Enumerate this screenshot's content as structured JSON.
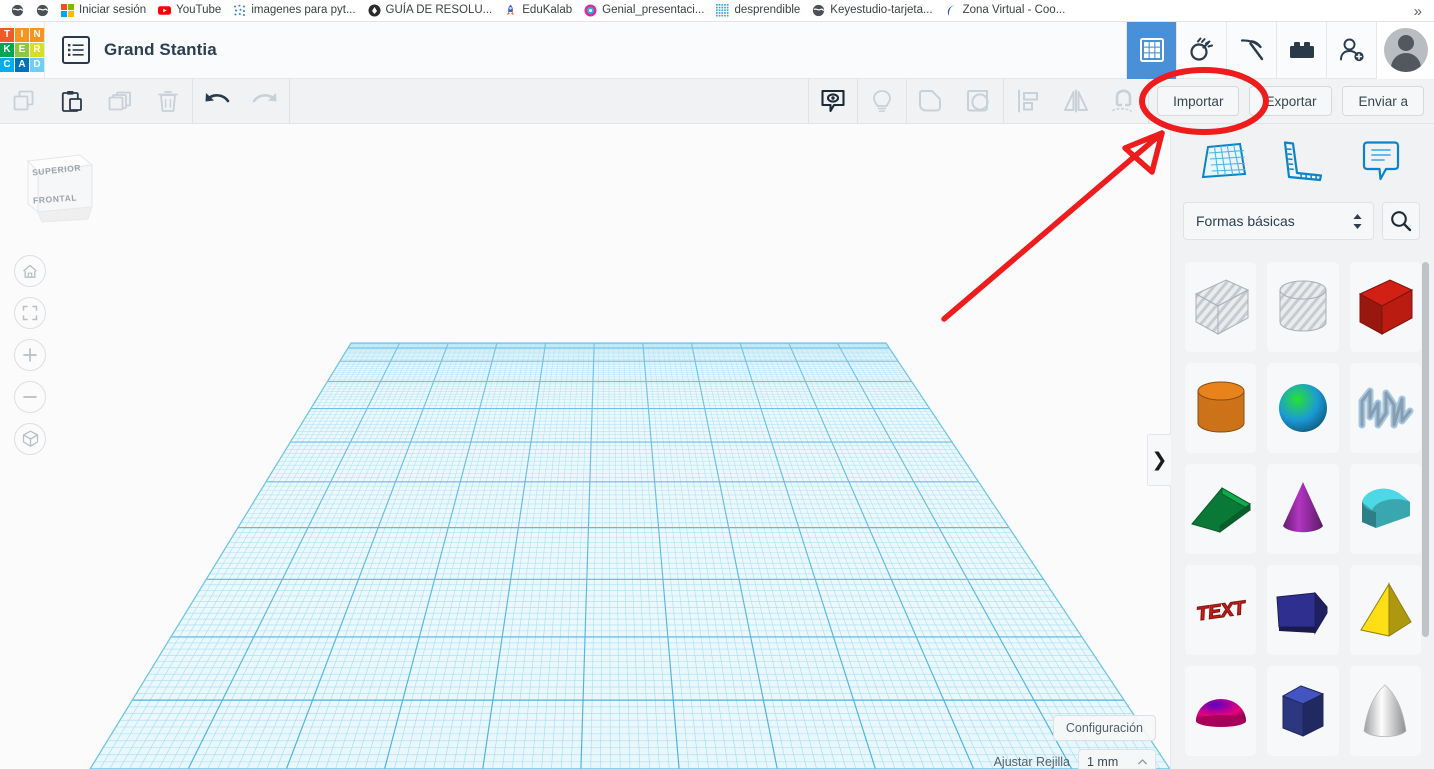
{
  "browser": {
    "bookmarks": [
      {
        "label": "",
        "icon": "globe-icon"
      },
      {
        "label": "",
        "icon": "globe-icon"
      },
      {
        "label": "Iniciar sesión",
        "icon": "microsoft-icon"
      },
      {
        "label": "YouTube",
        "icon": "youtube-icon"
      },
      {
        "label": "imagenes para pyt...",
        "icon": "dots-icon"
      },
      {
        "label": "GUÍA DE RESOLU...",
        "icon": "circle-badge-icon"
      },
      {
        "label": "EduKalab",
        "icon": "rocket-icon"
      },
      {
        "label": "Genial_presentaci...",
        "icon": "genially-icon"
      },
      {
        "label": "desprendible",
        "icon": "grid-dots-icon"
      },
      {
        "label": "Keyestudio-tarjeta...",
        "icon": "globe-icon"
      },
      {
        "label": "Zona Virtual - Coo...",
        "icon": "chevron-left-icon"
      }
    ],
    "overflow_label": "»"
  },
  "header": {
    "logo_letters": [
      {
        "char": "T",
        "color": "#f05a28"
      },
      {
        "char": "I",
        "color": "#f7941e"
      },
      {
        "char": "N",
        "color": "#f7941e"
      },
      {
        "char": "K",
        "color": "#00a651"
      },
      {
        "char": "E",
        "color": "#8dc63f"
      },
      {
        "char": "R",
        "color": "#d7df23"
      },
      {
        "char": "C",
        "color": "#00aeef"
      },
      {
        "char": "A",
        "color": "#0072bc"
      },
      {
        "char": "D",
        "color": "#6dcff6"
      }
    ],
    "project_title": "Grand Stantia",
    "list_button": "project-list-icon",
    "right_icons": [
      {
        "name": "designs-grid-icon",
        "active": true
      },
      {
        "name": "codeblocks-icon",
        "active": false
      },
      {
        "name": "pickaxe-minecraft-icon",
        "active": false
      },
      {
        "name": "lego-brick-icon",
        "active": false
      },
      {
        "name": "add-user-icon",
        "active": false
      }
    ],
    "accent_color": "#4a90d9"
  },
  "toolbar": {
    "left_icons": [
      {
        "name": "copy-icon",
        "enabled": false
      },
      {
        "name": "paste-icon",
        "enabled": true
      },
      {
        "name": "duplicate-icon",
        "enabled": false
      },
      {
        "name": "delete-trash-icon",
        "enabled": false
      }
    ],
    "history_icons": [
      {
        "name": "undo-icon",
        "enabled": true
      },
      {
        "name": "redo-icon",
        "enabled": false
      }
    ],
    "center_icons": [
      {
        "name": "note-comment-icon",
        "enabled": true
      },
      {
        "name": "lightbulb-hint-icon",
        "enabled": false
      },
      {
        "name": "group-shapes-icon",
        "enabled": false
      },
      {
        "name": "ungroup-shapes-icon",
        "enabled": false
      },
      {
        "name": "align-icon",
        "enabled": false
      },
      {
        "name": "mirror-flip-icon",
        "enabled": false
      },
      {
        "name": "magnet-snap-icon",
        "enabled": false
      }
    ],
    "buttons": [
      {
        "label": "Importar",
        "name": "import-button"
      },
      {
        "label": "Exportar",
        "name": "export-button"
      },
      {
        "label": "Enviar a",
        "name": "send-to-button"
      }
    ]
  },
  "canvas": {
    "viewcube": {
      "top_label": "SUPERIOR",
      "front_label": "FRONTAL"
    },
    "nav_buttons": [
      {
        "name": "home-view-button",
        "icon": "home-icon"
      },
      {
        "name": "fit-to-view-button",
        "icon": "fit-frame-icon"
      },
      {
        "name": "zoom-in-button",
        "icon": "plus-icon"
      },
      {
        "name": "zoom-out-button",
        "icon": "minus-icon"
      },
      {
        "name": "perspective-toggle-button",
        "icon": "cube-perspective-icon"
      }
    ],
    "settings_label": "Configuración",
    "snap_label": "Ajustar Rejilla",
    "snap_value": "1 mm",
    "grid_minor_color": "#b6e4f5",
    "grid_major_color": "#4cb8e8"
  },
  "panel": {
    "tab_icons": [
      {
        "name": "workplane-icon"
      },
      {
        "name": "ruler-icon"
      },
      {
        "name": "note-icon"
      }
    ],
    "category_value": "Formas básicas",
    "search_icon": "search-icon",
    "collapse_icon": "chevron-right-icon",
    "shapes": [
      {
        "name": "box-hole",
        "label": "Caja hueco",
        "color": "#c9ced3",
        "kind": "box",
        "hole": true
      },
      {
        "name": "cylinder-hole",
        "label": "Cilindro hueco",
        "color": "#c9ced3",
        "kind": "cyl",
        "hole": true
      },
      {
        "name": "box-red",
        "label": "Caja",
        "color": "#d32015",
        "kind": "box",
        "hole": false
      },
      {
        "name": "cylinder-orange",
        "label": "Cilindro",
        "color": "#e8821b",
        "kind": "cyl",
        "hole": false
      },
      {
        "name": "sphere-blue",
        "label": "Esfera",
        "color": "#1b9ad6",
        "kind": "sphere",
        "hole": false
      },
      {
        "name": "scribble-blue",
        "label": "Garabato",
        "color": "#a8c6dd",
        "kind": "scribble",
        "hole": false
      },
      {
        "name": "wedge-green",
        "label": "Cuña",
        "color": "#0d9a45",
        "kind": "wedge",
        "hole": false
      },
      {
        "name": "cone-purple",
        "label": "Cono",
        "color": "#8e2a9b",
        "kind": "cone",
        "hole": false
      },
      {
        "name": "roof-teal",
        "label": "Techo redondeado",
        "color": "#3fb5bf",
        "kind": "roof",
        "hole": false
      },
      {
        "name": "text-red",
        "label": "Texto",
        "color": "#d8201a",
        "kind": "text",
        "hole": false
      },
      {
        "name": "polygon-blue",
        "label": "Polígono",
        "color": "#2f2f8f",
        "kind": "poly",
        "hole": false
      },
      {
        "name": "pyramid-yellow",
        "label": "Pirámide",
        "color": "#f2d316",
        "kind": "pyr",
        "hole": false
      },
      {
        "name": "halfsphere-pink",
        "label": "Media esfera",
        "color": "#e7007f",
        "kind": "dome",
        "hole": false
      },
      {
        "name": "hexprism-blue",
        "label": "Prisma hexagonal",
        "color": "#36439b",
        "kind": "hex",
        "hole": false
      },
      {
        "name": "paraboloid-gray",
        "label": "Paraboloide",
        "color": "#c5c7c9",
        "kind": "parab",
        "hole": false
      }
    ]
  },
  "annotation": {
    "color": "#ee1c1c",
    "target_label": "Importar",
    "shapes": [
      "ellipse-highlight",
      "arrow-pointer"
    ]
  }
}
